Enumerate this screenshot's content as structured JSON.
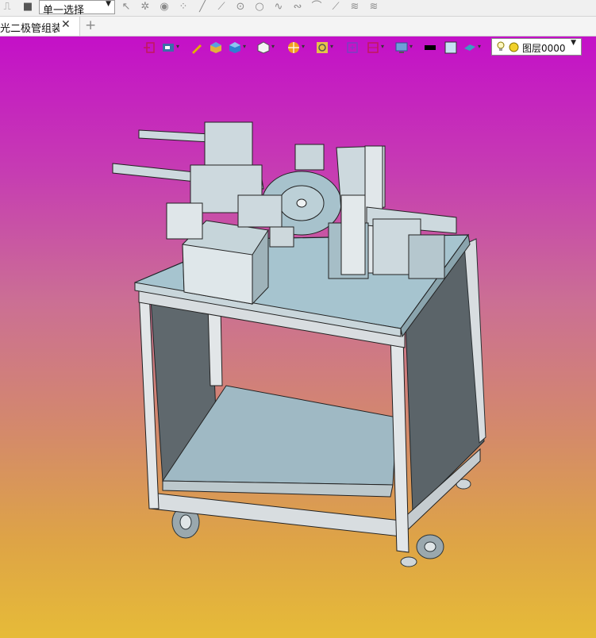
{
  "toolbar": {
    "selection_mode": "单一选择"
  },
  "tabs": {
    "document_tab": "光二极管组装]",
    "close_glyph": "✕",
    "add_glyph": "+"
  },
  "view_toolbar": {
    "layer_name": "图层0000"
  },
  "colors": {
    "viewport_top": "#c410c8",
    "viewport_bottom": "#e6bb38",
    "model_panel": "#a6c4cf",
    "frame": "#d8dde0"
  }
}
